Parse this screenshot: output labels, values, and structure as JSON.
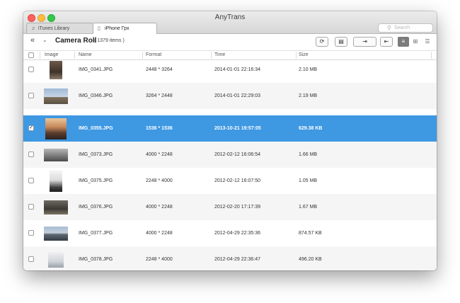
{
  "window": {
    "title": "AnyTrans"
  },
  "tabs": [
    {
      "label": "iTunes Library",
      "icon": "music-note-icon"
    },
    {
      "label": "iPhone Грх",
      "icon": "phone-icon"
    }
  ],
  "search": {
    "placeholder": "Search"
  },
  "toolbar": {
    "location": "Camera Roll",
    "count": "( 1379 items )"
  },
  "columns": {
    "image": "Image",
    "name": "Name",
    "format": "Format",
    "time": "Time",
    "size": "Size"
  },
  "rows": [
    {
      "name": "IMG_0341.JPG",
      "format": "2448 * 3264",
      "time": "2014-01-01 22:16:34",
      "size": "2.10 MB",
      "checked": false,
      "thumb": "portrait-brown"
    },
    {
      "name": "IMG_0346.JPG",
      "format": "3264 * 2448",
      "time": "2014-01-01 22:29:03",
      "size": "2.19 MB",
      "checked": false,
      "thumb": "landscape-sky"
    },
    {
      "name": "IMG_0355.JPG",
      "format": "1536 * 1536",
      "time": "2013-10-21 19:57:05",
      "size": "629.38 KB",
      "checked": true,
      "thumb": "square-sunset"
    },
    {
      "name": "IMG_0373.JPG",
      "format": "4000 * 2248",
      "time": "2012-02-12 16:06:54",
      "size": "1.66 MB",
      "checked": false,
      "thumb": "landscape-gray"
    },
    {
      "name": "IMG_0375.JPG",
      "format": "2248 * 4000",
      "time": "2012-02-12 16:07:50",
      "size": "1.05 MB",
      "checked": false,
      "thumb": "portrait-light"
    },
    {
      "name": "IMG_0376.JPG",
      "format": "4000 * 2248",
      "time": "2012-02-20 17:17:39",
      "size": "1.67 MB",
      "checked": false,
      "thumb": "landscape-dark"
    },
    {
      "name": "IMG_0377.JPG",
      "format": "4000 * 2248",
      "time": "2012-04-29 22:35:36",
      "size": "874.57 KB",
      "checked": false,
      "thumb": "landscape-water"
    },
    {
      "name": "IMG_0378.JPG",
      "format": "2248 * 4000",
      "time": "2012-04-29 22:36:47",
      "size": "496.20 KB",
      "checked": false,
      "thumb": "portrait-pale"
    }
  ],
  "colors": {
    "selection": "#3e98e2",
    "alt_row": "#f5f5f5"
  }
}
